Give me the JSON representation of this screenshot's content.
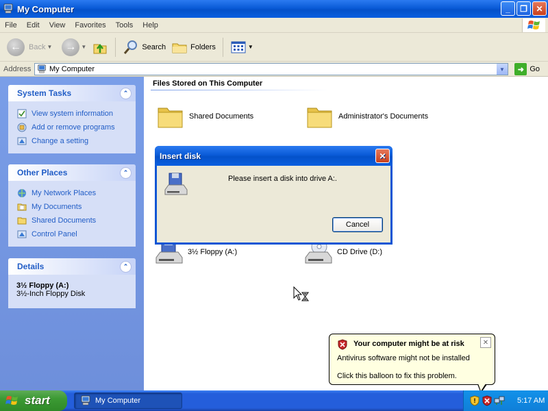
{
  "window": {
    "title": "My Computer",
    "controls": [
      "_",
      "❐",
      "✕"
    ]
  },
  "menu": [
    "File",
    "Edit",
    "View",
    "Favorites",
    "Tools",
    "Help"
  ],
  "toolbar": {
    "back_label": "Back",
    "search_label": "Search",
    "folders_label": "Folders"
  },
  "address": {
    "label": "Address",
    "value": "My Computer",
    "go_label": "Go"
  },
  "sidebar": {
    "system_tasks": {
      "title": "System Tasks",
      "items": [
        {
          "label": "View system information",
          "icon": "system-info-icon"
        },
        {
          "label": "Add or remove programs",
          "icon": "add-remove-icon"
        },
        {
          "label": "Change a setting",
          "icon": "control-panel-icon"
        }
      ]
    },
    "other_places": {
      "title": "Other Places",
      "items": [
        {
          "label": "My Network Places",
          "icon": "network-icon"
        },
        {
          "label": "My Documents",
          "icon": "documents-icon"
        },
        {
          "label": "Shared Documents",
          "icon": "folder-icon"
        },
        {
          "label": "Control Panel",
          "icon": "control-panel-icon"
        }
      ]
    },
    "details": {
      "title": "Details",
      "name": "3½ Floppy (A:)",
      "description": "3½-Inch Floppy Disk"
    }
  },
  "main": {
    "group_title": "Files Stored on This Computer",
    "items": [
      {
        "label": "Shared Documents",
        "icon": "folder-icon"
      },
      {
        "label": "Administrator's Documents",
        "icon": "folder-icon"
      },
      {
        "label": "3½ Floppy (A:)",
        "icon": "floppy-drive-icon"
      },
      {
        "label": "CD Drive (D:)",
        "icon": "cd-drive-icon"
      }
    ]
  },
  "dialog": {
    "title": "Insert disk",
    "message": "Please insert a disk into drive A:.",
    "button": "Cancel"
  },
  "balloon": {
    "title": "Your computer might be at risk",
    "line1": "Antivirus software might not be installed",
    "line2": "Click this balloon to fix this problem."
  },
  "taskbar": {
    "start_label": "start",
    "task_label": "My Computer",
    "clock": "5:17 AM"
  },
  "colors": {
    "title_blue": "#0a5bd8",
    "sidebar_link": "#215dc6",
    "taskbar_blue": "#245edb",
    "start_green": "#3c9a34",
    "balloon_bg": "#ffffe1"
  }
}
